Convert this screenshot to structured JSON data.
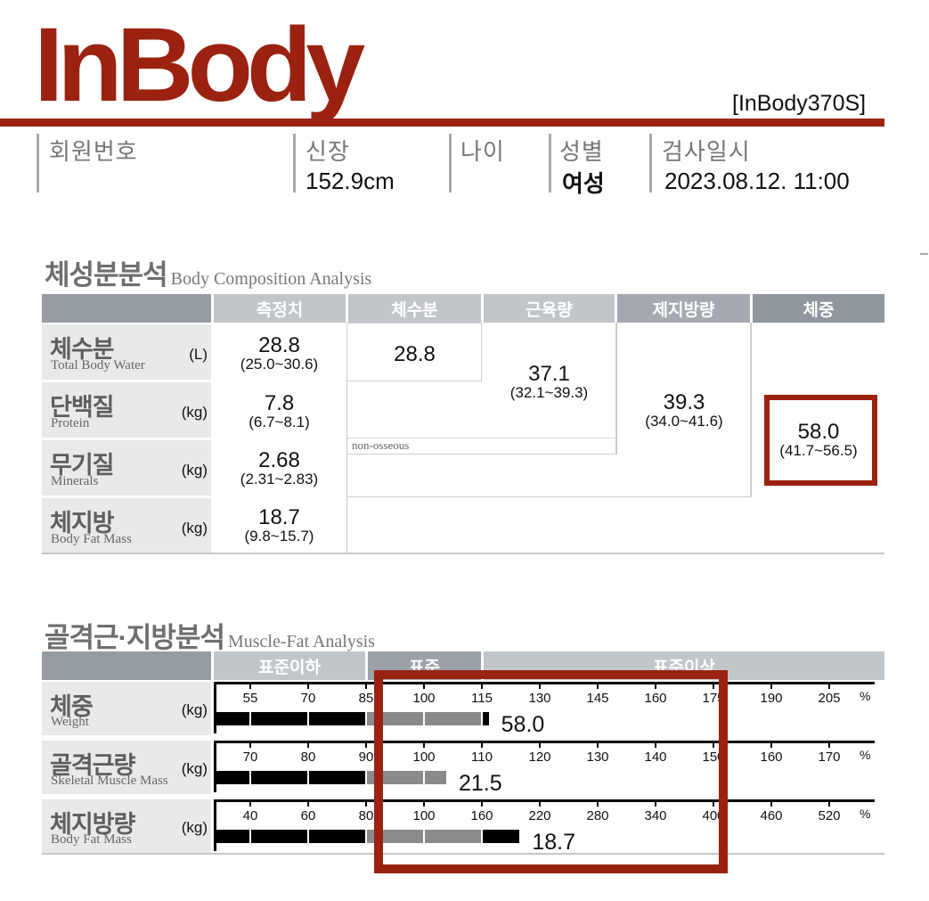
{
  "header": {
    "logo": "InBody",
    "model": "[InBody370S]",
    "brand_color": "#9B2210"
  },
  "info": {
    "member_no_label": "회원번호",
    "member_no_value": "",
    "height_label": "신장",
    "height_value": "152.9cm",
    "age_label": "나이",
    "age_value": "",
    "sex_label": "성별",
    "sex_value": "여성",
    "date_label": "검사일시",
    "date_value": "2023.08.12. 11:00"
  },
  "body_composition": {
    "title_ko": "체성분분석",
    "title_en": "Body Composition Analysis",
    "columns": [
      "측정치",
      "체수분",
      "근육량",
      "제지방량",
      "체중"
    ],
    "rows": [
      {
        "ko": "체수분",
        "en": "Total Body Water",
        "unit": "(L)",
        "value": "28.8",
        "range": "(25.0~30.6)"
      },
      {
        "ko": "단백질",
        "en": "Protein",
        "unit": "(kg)",
        "value": "7.8",
        "range": "(6.7~8.1)"
      },
      {
        "ko": "무기질",
        "en": "Minerals",
        "unit": "(kg)",
        "value": "2.68",
        "range": "(2.31~2.83)"
      },
      {
        "ko": "체지방",
        "en": "Body Fat Mass",
        "unit": "(kg)",
        "value": "18.7",
        "range": "(9.8~15.7)"
      }
    ],
    "total_body_water": "28.8",
    "muscle": {
      "value": "37.1",
      "range": "(32.1~39.3)"
    },
    "non_osseous_label": "non-osseous",
    "fat_free_mass": {
      "value": "39.3",
      "range": "(34.0~41.6)"
    },
    "weight": {
      "value": "58.0",
      "range": "(41.7~56.5)"
    }
  },
  "muscle_fat": {
    "title_ko": "골격근·지방분석",
    "title_en": "Muscle-Fat Analysis",
    "bands": [
      "표준이하",
      "표준",
      "표준이상"
    ],
    "percent_symbol": "%",
    "rows": [
      {
        "ko": "체중",
        "en": "Weight",
        "unit": "(kg)",
        "ticks": [
          "55",
          "70",
          "85",
          "100",
          "115",
          "130",
          "145",
          "160",
          "175",
          "190",
          "205"
        ],
        "value": "58.0",
        "percent": 117
      },
      {
        "ko": "골격근량",
        "en": "Skeletal Muscle Mass",
        "unit": "(kg)",
        "ticks": [
          "70",
          "80",
          "90",
          "100",
          "110",
          "120",
          "130",
          "140",
          "150",
          "160",
          "170"
        ],
        "value": "21.5",
        "percent": 104
      },
      {
        "ko": "체지방량",
        "en": "Body Fat Mass",
        "unit": "(kg)",
        "ticks": [
          "40",
          "60",
          "80",
          "100",
          "160",
          "220",
          "280",
          "340",
          "400",
          "460",
          "520"
        ],
        "value": "18.7",
        "percent": 200
      }
    ]
  },
  "chart_data": {
    "type": "bar",
    "title": "Muscle-Fat Analysis",
    "categories": [
      "Weight",
      "Skeletal Muscle Mass",
      "Body Fat Mass"
    ],
    "values": [
      58.0,
      21.5,
      18.7
    ],
    "percent_of_standard": [
      117,
      104,
      200
    ],
    "xlabel": "%",
    "ylabel": "kg",
    "bands": [
      "표준이하",
      "표준",
      "표준이상"
    ]
  }
}
